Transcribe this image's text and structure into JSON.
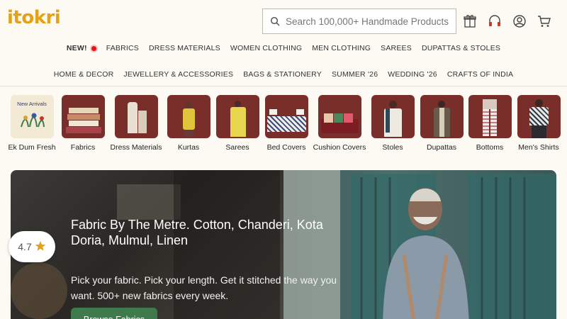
{
  "brand": {
    "logo_text": "itokri",
    "accent": "#e3a21a"
  },
  "search": {
    "placeholder": "Search 100,000+ Handmade Products"
  },
  "header_icons": [
    "gift-icon",
    "headset-icon",
    "user-icon",
    "cart-icon"
  ],
  "nav_row1": {
    "new_label": "NEW!",
    "items": [
      "FABRICS",
      "DRESS MATERIALS",
      "WOMEN CLOTHING",
      "MEN CLOTHING",
      "SAREES",
      "DUPATTAS & STOLES"
    ]
  },
  "nav_row2": {
    "items": [
      "HOME & DECOR",
      "JEWELLERY & ACCESSORIES",
      "BAGS & STATIONERY",
      "SUMMER '26",
      "WEDDING '26",
      "CRAFTS OF INDIA"
    ]
  },
  "categories": [
    {
      "label": "Ek Dum Fresh",
      "thumb_text": "New Arrivals"
    },
    {
      "label": "Fabrics"
    },
    {
      "label": "Dress Materials"
    },
    {
      "label": "Kurtas"
    },
    {
      "label": "Sarees"
    },
    {
      "label": "Bed Covers"
    },
    {
      "label": "Cushion Covers"
    },
    {
      "label": "Stoles"
    },
    {
      "label": "Dupattas"
    },
    {
      "label": "Bottoms"
    },
    {
      "label": "Men's Shirts"
    }
  ],
  "hero": {
    "title": "Fabric By The Metre. Cotton, Chanderi, Kota Doria, Mulmul, Linen",
    "subtitle": "Pick your fabric. Pick your length. Get it stitched the way you want. 500+ new fabrics every week.",
    "button": "Browse Fabrics",
    "button_color": "#3e7a4c"
  },
  "rating": {
    "value": "4.7",
    "icon": "star-icon",
    "star_color": "#e3a21a"
  }
}
